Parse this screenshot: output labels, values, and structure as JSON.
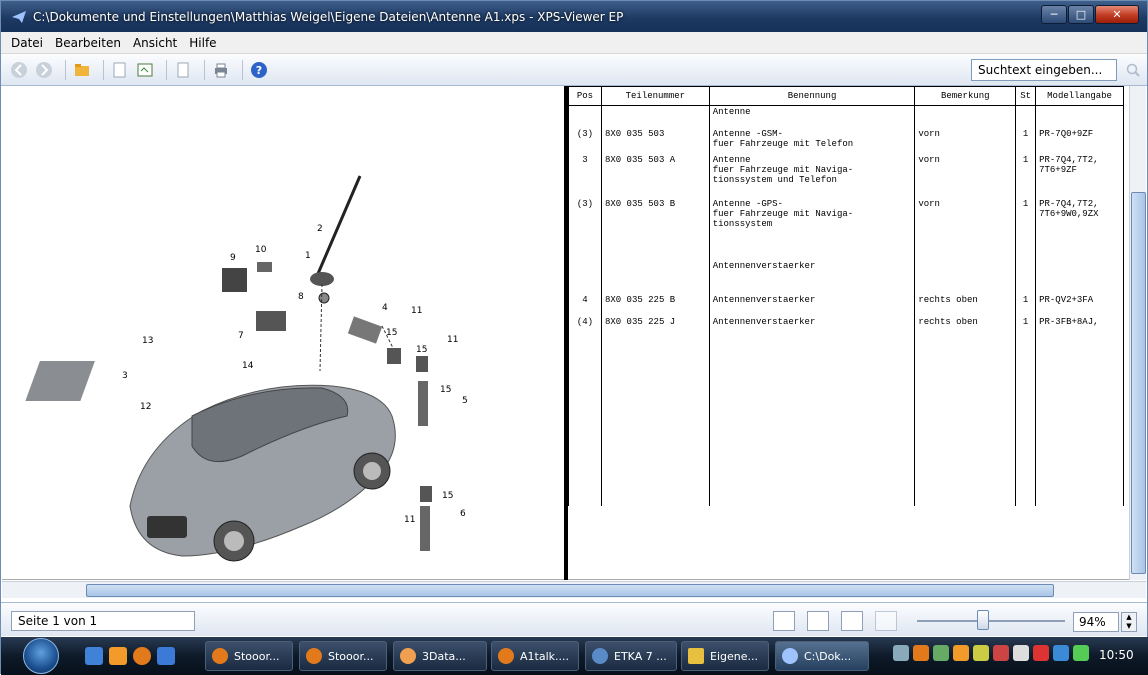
{
  "window": {
    "title": "C:\\Dokumente und Einstellungen\\Matthias  Weigel\\Eigene Dateien\\Antenne A1.xps - XPS-Viewer EP",
    "min": "─",
    "max": "□",
    "close": "✕"
  },
  "menu": [
    "Datei",
    "Bearbeiten",
    "Ansicht",
    "Hilfe"
  ],
  "toolbar": {
    "search_placeholder": "Suchtext eingeben..."
  },
  "table": {
    "headers": [
      "Pos",
      "Teilenummer",
      "Benennung",
      "Bemerkung",
      "St",
      "Modellangabe"
    ],
    "rows": [
      {
        "pos": "",
        "teil": "",
        "ben": "Antenne",
        "bem": "",
        "st": "",
        "mod": ""
      },
      {
        "pos": "(3)",
        "teil": "8X0 035 503",
        "ben": "Antenne -GSM-\nfuer Fahrzeuge mit Telefon",
        "bem": "vorn",
        "st": "1",
        "mod": "PR-7Q0+9ZF"
      },
      {
        "pos": "3",
        "teil": "8X0 035 503 A",
        "ben": "Antenne\nfuer Fahrzeuge mit Naviga-\ntionssystem und Telefon",
        "bem": "vorn",
        "st": "1",
        "mod": "PR-7Q4,7T2,\n7T6+9ZF"
      },
      {
        "pos": "(3)",
        "teil": "8X0 035 503 B",
        "ben": "Antenne -GPS-\nfuer Fahrzeuge mit Naviga-\ntionssystem",
        "bem": "vorn",
        "st": "1",
        "mod": "PR-7Q4,7T2,\n7T6+9W0,9ZX"
      },
      {
        "pos": "",
        "teil": "",
        "ben": "Antennenverstaerker",
        "bem": "",
        "st": "",
        "mod": ""
      },
      {
        "pos": "4",
        "teil": "8X0 035 225 B",
        "ben": "Antennenverstaerker",
        "bem": "rechts oben",
        "st": "1",
        "mod": "PR-QV2+3FA"
      },
      {
        "pos": "(4)",
        "teil": "8X0 035 225 J",
        "ben": "Antennenverstaerker",
        "bem": "rechts oben",
        "st": "1",
        "mod": "PR-3FB+8AJ,"
      }
    ]
  },
  "diagram": {
    "labels": [
      "1",
      "2",
      "3",
      "4",
      "5",
      "6",
      "7",
      "8",
      "9",
      "10",
      "11",
      "11",
      "11",
      "12",
      "13",
      "14",
      "15",
      "15",
      "15",
      "15"
    ]
  },
  "status": {
    "page": "Seite 1 von 1",
    "zoom": "94%"
  },
  "taskbar": {
    "items": [
      "Stooor...",
      "Stooor...",
      "3Data...",
      "A1talk....",
      "ETKA 7 ...",
      "Eigene...",
      "C:\\Dok..."
    ],
    "clock": "10:50"
  }
}
